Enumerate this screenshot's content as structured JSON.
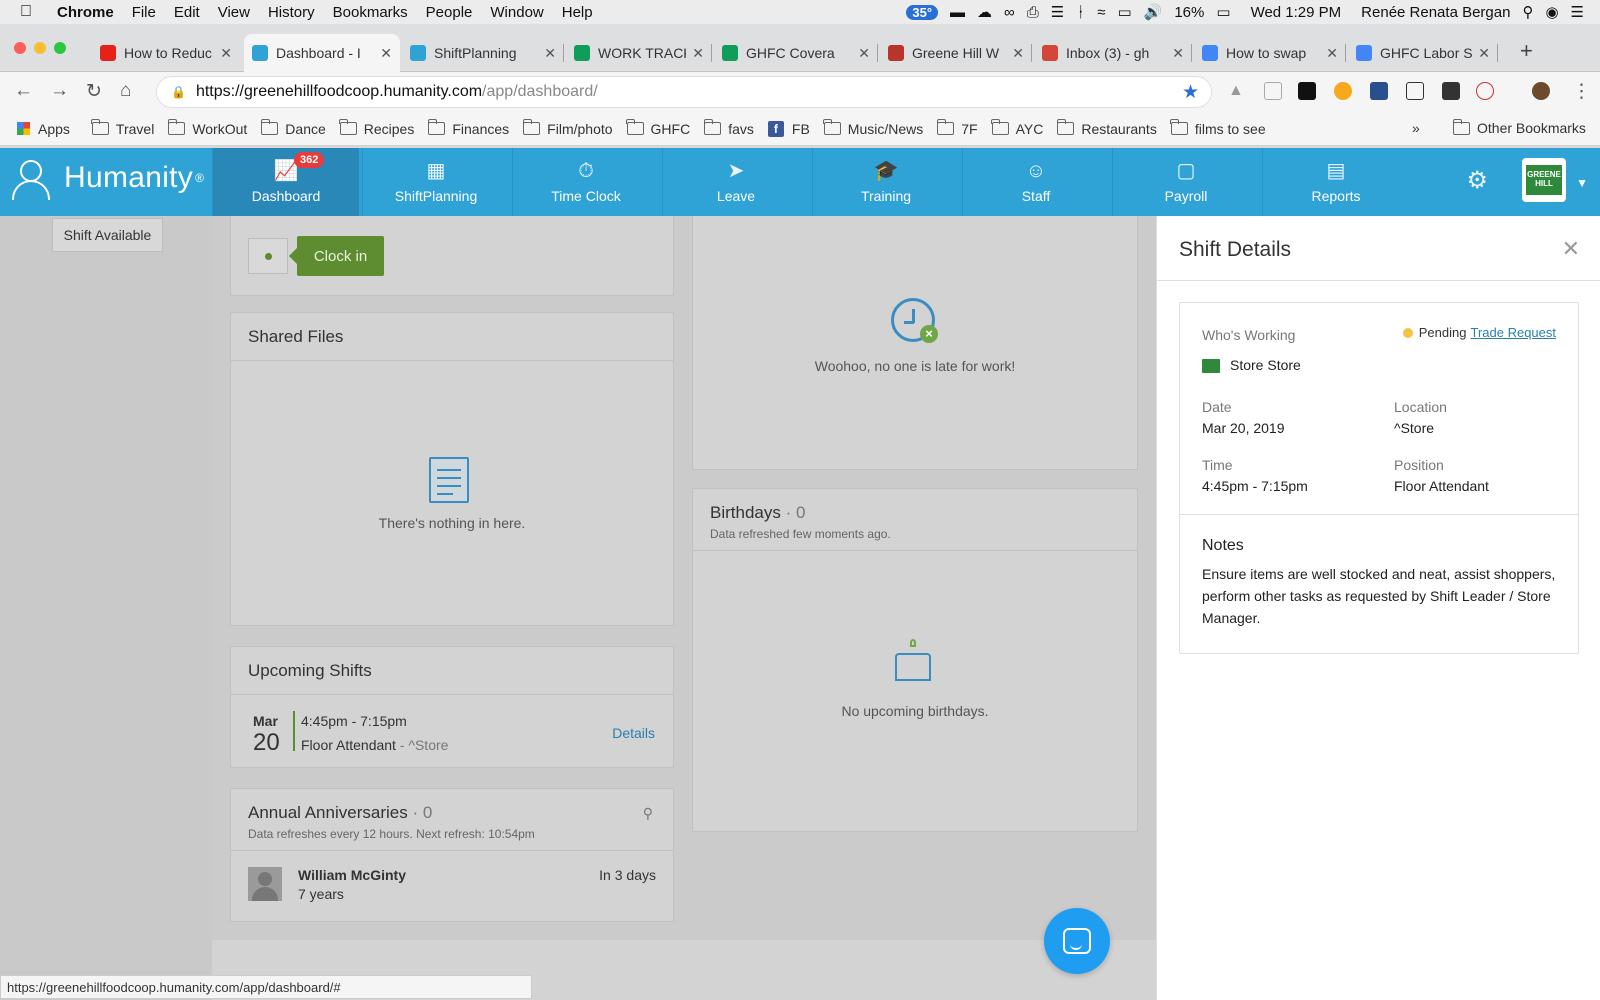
{
  "macbar": {
    "app": "Chrome",
    "menus": [
      "File",
      "Edit",
      "View",
      "History",
      "Bookmarks",
      "People",
      "Window",
      "Help"
    ],
    "temp": "35°",
    "battery": "16%",
    "clock": "Wed 1:29 PM",
    "user": "Renée Renata Bergan"
  },
  "tabs": [
    {
      "title": "How to Reduc",
      "color": "#e62117"
    },
    {
      "title": "Dashboard - I",
      "color": "#2fa2d6"
    },
    {
      "title": "ShiftPlanning",
      "color": "#2fa2d6"
    },
    {
      "title": "WORK TRACK",
      "color": "#0f9d58"
    },
    {
      "title": "GHFC Covera",
      "color": "#0f9d58"
    },
    {
      "title": "Greene Hill W",
      "color": "#b9342a"
    },
    {
      "title": "Inbox (3) - gh",
      "color": "#d44638"
    },
    {
      "title": "How to swap",
      "color": "#4285f4"
    },
    {
      "title": "GHFC Labor S",
      "color": "#4285f4"
    }
  ],
  "address": {
    "host": "https://greenehillfoodcoop.humanity.com",
    "path": "/app/dashboard/"
  },
  "bookmarks": [
    "Apps",
    "Travel",
    "WorkOut",
    "Dance",
    "Recipes",
    "Finances",
    "Film/photo",
    "GHFC",
    "favs",
    "FB",
    "Music/News",
    "7F",
    "AYC",
    "Restaurants",
    "films to see"
  ],
  "other_bookmarks": "Other Bookmarks",
  "nav": {
    "logo": "Humanity",
    "tabs": [
      {
        "label": "Dashboard",
        "icon": "chart-icon"
      },
      {
        "label": "ShiftPlanning",
        "icon": "calendar-grid-icon"
      },
      {
        "label": "Time Clock",
        "icon": "stopwatch-icon"
      },
      {
        "label": "Leave",
        "icon": "rocket-icon"
      },
      {
        "label": "Training",
        "icon": "graduation-cap-icon"
      },
      {
        "label": "Staff",
        "icon": "person-icon"
      },
      {
        "label": "Payroll",
        "icon": "wallet-icon"
      },
      {
        "label": "Reports",
        "icon": "bar-chart-icon"
      }
    ],
    "badge": "362",
    "org_logo_text": "GREENE HILL"
  },
  "dashboard": {
    "shift_available": "Shift Available",
    "clock_in": "Clock in",
    "shared_files": {
      "title": "Shared Files",
      "empty": "There's nothing in here."
    },
    "late": {
      "empty": "Woohoo, no one is late for work!"
    },
    "birthdays": {
      "title": "Birthdays",
      "count": "· 0",
      "refresh": "Data refreshed few moments ago.",
      "empty": "No upcoming birthdays."
    },
    "upcoming": {
      "title": "Upcoming Shifts",
      "month": "Mar",
      "day": "20",
      "time": "4:45pm - 7:15pm",
      "position": "Floor Attendant",
      "location": " - ^Store",
      "details": "Details"
    },
    "anniversaries": {
      "title": "Annual Anniversaries",
      "count": "· 0",
      "refresh": "Data refreshes every 12 hours. Next refresh: 10:54pm",
      "name": "William McGinty",
      "years": "7 years",
      "when": "In 3 days"
    }
  },
  "panel": {
    "title": "Shift Details",
    "whos_working_label": "Who's Working",
    "pending": "Pending",
    "trade_request": "Trade Request",
    "worker": "Store Store",
    "date_label": "Date",
    "date": "Mar 20, 2019",
    "location_label": "Location",
    "location": "^Store",
    "time_label": "Time",
    "time": "4:45pm - 7:15pm",
    "position_label": "Position",
    "position": "Floor Attendant",
    "notes_label": "Notes",
    "notes": "Ensure items are well stocked and neat, assist shoppers, perform other tasks as requested by Shift Leader / Store Manager."
  },
  "status_url": "https://greenehillfoodcoop.humanity.com/app/dashboard/#"
}
